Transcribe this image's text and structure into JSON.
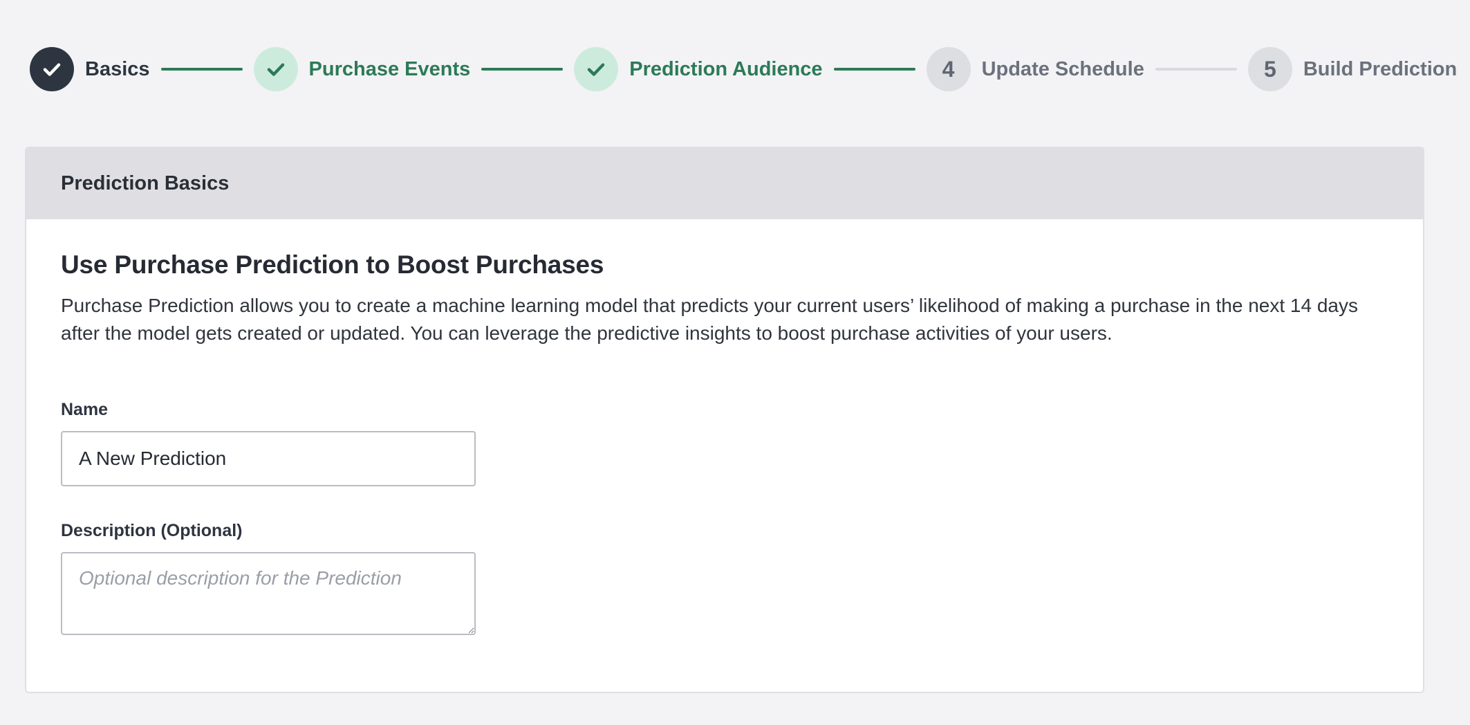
{
  "stepper": {
    "steps": [
      {
        "label": "Basics",
        "state": "active",
        "icon": "check-icon"
      },
      {
        "label": "Purchase Events",
        "state": "done",
        "icon": "check-icon"
      },
      {
        "label": "Prediction Audience",
        "state": "done",
        "icon": "check-icon"
      },
      {
        "label": "Update Schedule",
        "state": "todo",
        "number": "4"
      },
      {
        "label": "Build Prediction",
        "state": "todo",
        "number": "5"
      }
    ],
    "colors": {
      "active": "#2d3640",
      "done": "#2c7a57",
      "done_bg": "#cdebdd",
      "todo": "#6b717c",
      "todo_bg": "#dcdee2"
    }
  },
  "card": {
    "header_title": "Prediction Basics",
    "heading": "Use Purchase Prediction to Boost Purchases",
    "description": "Purchase Prediction allows you to create a machine learning model that predicts your current users’ likelihood of making a purchase in the next 14 days after the model gets created or updated. You can leverage the predictive insights to boost purchase activities of your users.",
    "name_field": {
      "label": "Name",
      "value": "A New Prediction"
    },
    "description_field": {
      "label": "Description (Optional)",
      "placeholder": "Optional description for the Prediction",
      "value": ""
    }
  }
}
